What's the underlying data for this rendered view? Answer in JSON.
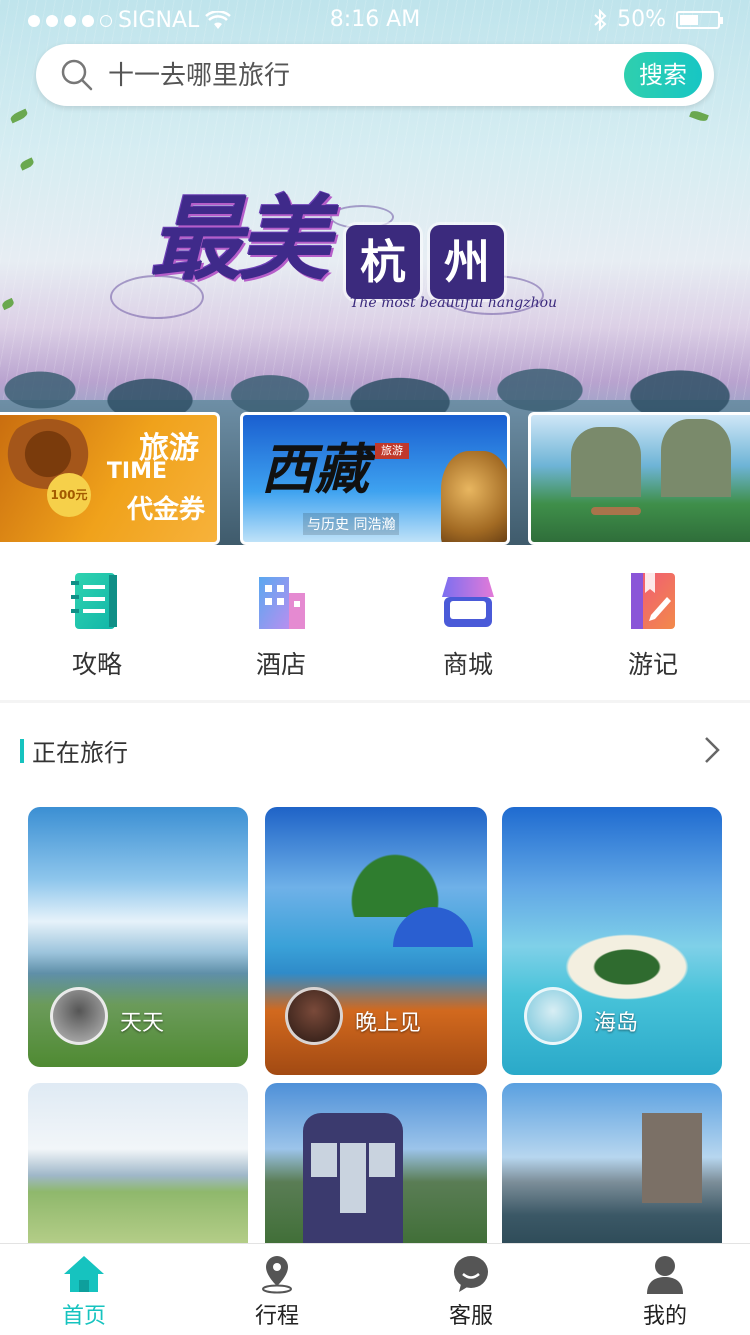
{
  "status_bar": {
    "carrier": "SIGNAL",
    "time": "8:16 AM",
    "battery": "50%",
    "battery_level": 0.5
  },
  "search": {
    "placeholder": "十一去哪里旅行",
    "button_label": "搜索"
  },
  "hero": {
    "title_script": "最美",
    "title_seal_1": "杭",
    "title_seal_2": "州",
    "subtitle": "The most beautiful hangzhou"
  },
  "banners": [
    {
      "name": "voucher",
      "line1": "旅游",
      "line2": "TIME",
      "line3": "代金券",
      "coin": "100元"
    },
    {
      "name": "tibet",
      "title": "西藏",
      "badge": "旅游",
      "caption": "与历史 同浩瀚"
    },
    {
      "name": "landscape"
    }
  ],
  "categories": [
    {
      "label": "攻略",
      "icon": "guide-book-icon"
    },
    {
      "label": "酒店",
      "icon": "hotel-building-icon"
    },
    {
      "label": "商城",
      "icon": "shop-icon"
    },
    {
      "label": "游记",
      "icon": "travel-notes-icon"
    }
  ],
  "section": {
    "title": "正在旅行"
  },
  "cards": [
    {
      "name": "天天"
    },
    {
      "name": "晚上见"
    },
    {
      "name": "海岛"
    },
    {
      "name": ""
    },
    {
      "name": ""
    },
    {
      "name": ""
    }
  ],
  "tabs": [
    {
      "label": "首页",
      "icon": "home-icon",
      "active": true
    },
    {
      "label": "行程",
      "icon": "location-pin-icon",
      "active": false
    },
    {
      "label": "客服",
      "icon": "chat-bubble-icon",
      "active": false
    },
    {
      "label": "我的",
      "icon": "user-icon",
      "active": false
    }
  ],
  "colors": {
    "accent": "#16c3bf",
    "accent_gradient_start": "#2fcfae"
  }
}
